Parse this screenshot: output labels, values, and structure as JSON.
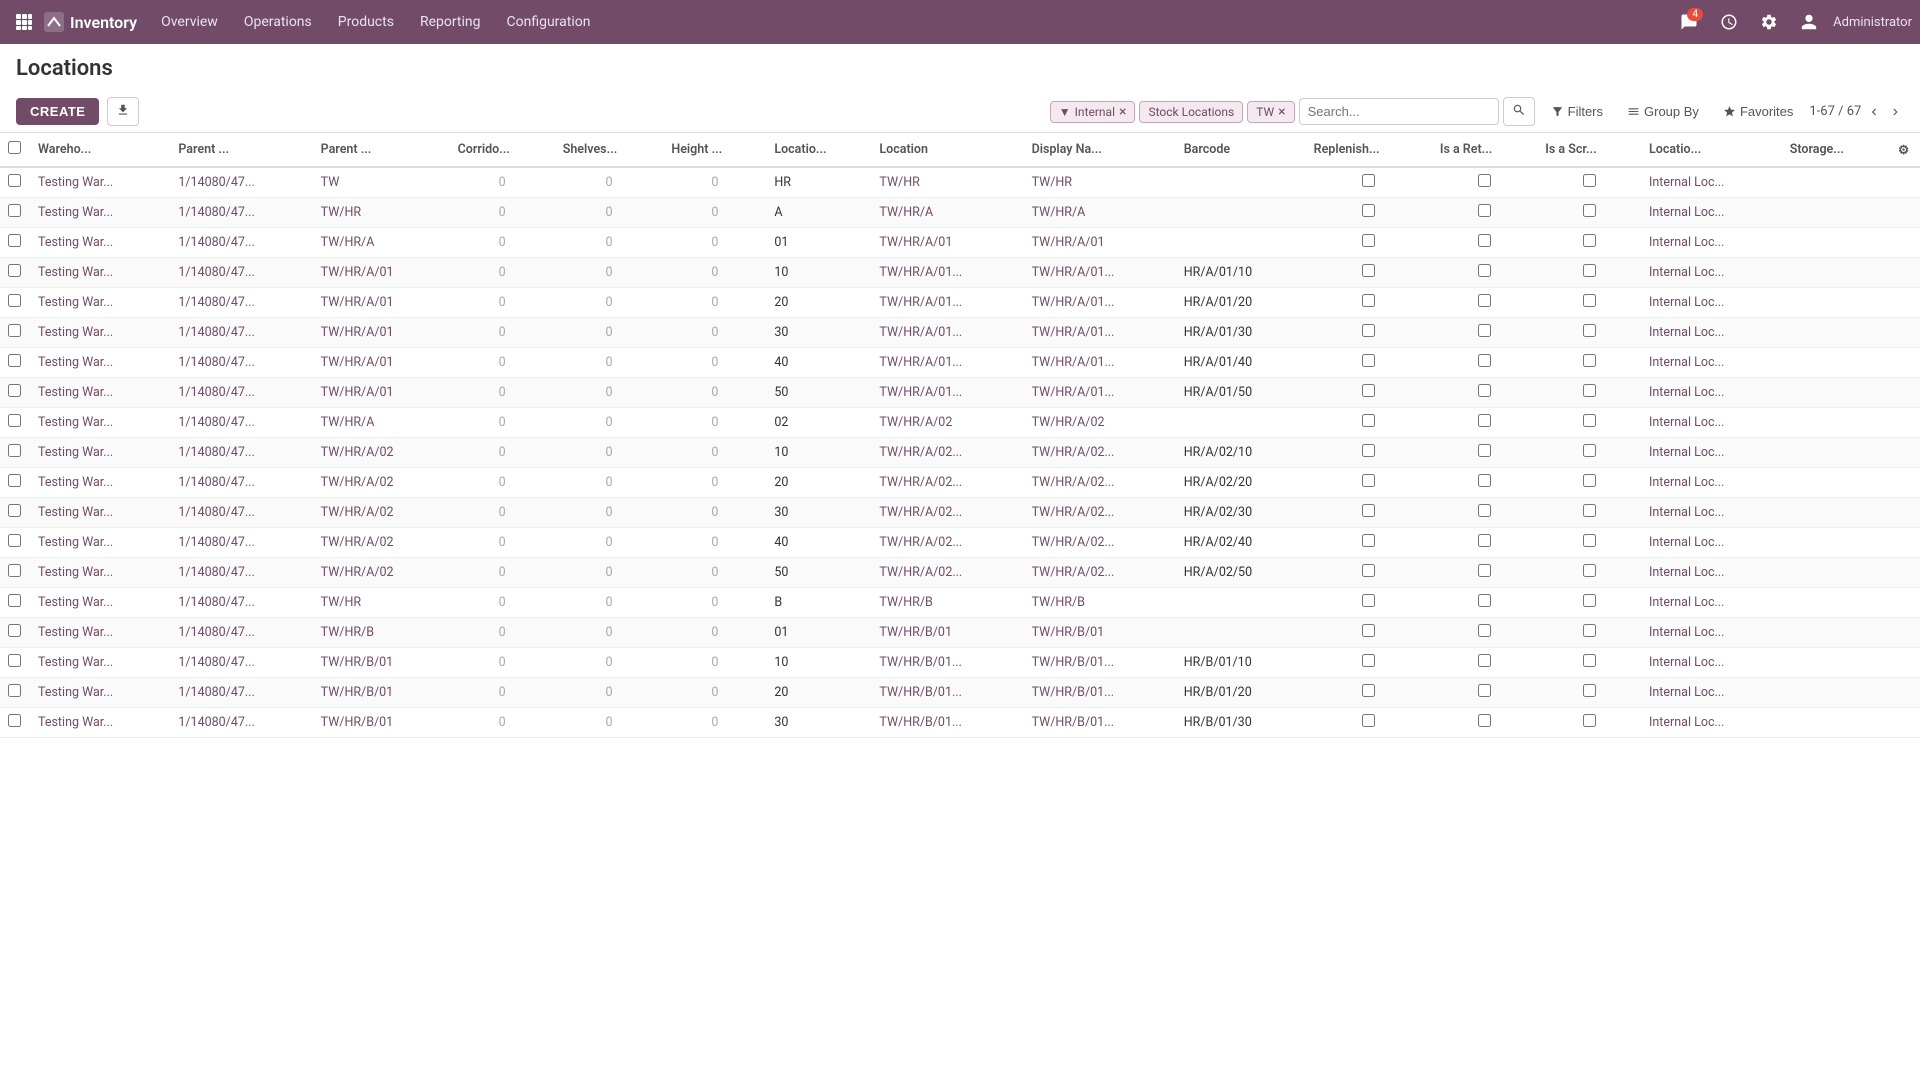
{
  "topnav": {
    "brand": "Inventory",
    "menu": [
      "Overview",
      "Operations",
      "Products",
      "Reporting",
      "Configuration"
    ],
    "chat_count": "4",
    "user": "Administrator"
  },
  "page": {
    "title": "Locations"
  },
  "toolbar": {
    "create_label": "CREATE",
    "filters_label": "Filters",
    "group_by_label": "Group By",
    "favorites_label": "Favorites",
    "pagination": "1-67 / 67"
  },
  "filters": [
    {
      "id": "internal",
      "label": "Internal",
      "removable": true
    },
    {
      "id": "stock",
      "label": "Stock Locations",
      "removable": false
    },
    {
      "id": "tw",
      "label": "TW",
      "removable": true
    }
  ],
  "search_placeholder": "Search...",
  "columns": [
    "Wareho...",
    "Parent ...",
    "Parent ...",
    "Corrido...",
    "Shelves...",
    "Height ...",
    "Locatio...",
    "Location",
    "Display Na...",
    "Barcode",
    "Replenish...",
    "Is a Ret...",
    "Is a Scr...",
    "Locatio...",
    "Storage..."
  ],
  "rows": [
    {
      "warehouse": "Testing War...",
      "parent1": "1/14080/47...",
      "parent2": "TW",
      "corridor": "0",
      "shelves": "0",
      "height": "0",
      "loc_type": "HR",
      "location": "TW/HR",
      "display_name": "TW/HR",
      "barcode": "",
      "replenish": false,
      "is_ret": false,
      "is_scr": false,
      "loc_usage": "Internal Loc...",
      "storage": ""
    },
    {
      "warehouse": "Testing War...",
      "parent1": "1/14080/47...",
      "parent2": "TW/HR",
      "corridor": "0",
      "shelves": "0",
      "height": "0",
      "loc_type": "A",
      "location": "TW/HR/A",
      "display_name": "TW/HR/A",
      "barcode": "",
      "replenish": false,
      "is_ret": false,
      "is_scr": false,
      "loc_usage": "Internal Loc...",
      "storage": ""
    },
    {
      "warehouse": "Testing War...",
      "parent1": "1/14080/47...",
      "parent2": "TW/HR/A",
      "corridor": "0",
      "shelves": "0",
      "height": "0",
      "loc_type": "01",
      "location": "TW/HR/A/01",
      "display_name": "TW/HR/A/01",
      "barcode": "",
      "replenish": false,
      "is_ret": false,
      "is_scr": false,
      "loc_usage": "Internal Loc...",
      "storage": ""
    },
    {
      "warehouse": "Testing War...",
      "parent1": "1/14080/47...",
      "parent2": "TW/HR/A/01",
      "corridor": "0",
      "shelves": "0",
      "height": "0",
      "loc_type": "10",
      "location": "TW/HR/A/01...",
      "display_name": "TW/HR/A/01...",
      "barcode": "HR/A/01/10",
      "replenish": false,
      "is_ret": false,
      "is_scr": false,
      "loc_usage": "Internal Loc...",
      "storage": ""
    },
    {
      "warehouse": "Testing War...",
      "parent1": "1/14080/47...",
      "parent2": "TW/HR/A/01",
      "corridor": "0",
      "shelves": "0",
      "height": "0",
      "loc_type": "20",
      "location": "TW/HR/A/01...",
      "display_name": "TW/HR/A/01...",
      "barcode": "HR/A/01/20",
      "replenish": false,
      "is_ret": false,
      "is_scr": false,
      "loc_usage": "Internal Loc...",
      "storage": ""
    },
    {
      "warehouse": "Testing War...",
      "parent1": "1/14080/47...",
      "parent2": "TW/HR/A/01",
      "corridor": "0",
      "shelves": "0",
      "height": "0",
      "loc_type": "30",
      "location": "TW/HR/A/01...",
      "display_name": "TW/HR/A/01...",
      "barcode": "HR/A/01/30",
      "replenish": false,
      "is_ret": false,
      "is_scr": false,
      "loc_usage": "Internal Loc...",
      "storage": ""
    },
    {
      "warehouse": "Testing War...",
      "parent1": "1/14080/47...",
      "parent2": "TW/HR/A/01",
      "corridor": "0",
      "shelves": "0",
      "height": "0",
      "loc_type": "40",
      "location": "TW/HR/A/01...",
      "display_name": "TW/HR/A/01...",
      "barcode": "HR/A/01/40",
      "replenish": false,
      "is_ret": false,
      "is_scr": false,
      "loc_usage": "Internal Loc...",
      "storage": ""
    },
    {
      "warehouse": "Testing War...",
      "parent1": "1/14080/47...",
      "parent2": "TW/HR/A/01",
      "corridor": "0",
      "shelves": "0",
      "height": "0",
      "loc_type": "50",
      "location": "TW/HR/A/01...",
      "display_name": "TW/HR/A/01...",
      "barcode": "HR/A/01/50",
      "replenish": false,
      "is_ret": false,
      "is_scr": false,
      "loc_usage": "Internal Loc...",
      "storage": ""
    },
    {
      "warehouse": "Testing War...",
      "parent1": "1/14080/47...",
      "parent2": "TW/HR/A",
      "corridor": "0",
      "shelves": "0",
      "height": "0",
      "loc_type": "02",
      "location": "TW/HR/A/02",
      "display_name": "TW/HR/A/02",
      "barcode": "",
      "replenish": false,
      "is_ret": false,
      "is_scr": false,
      "loc_usage": "Internal Loc...",
      "storage": ""
    },
    {
      "warehouse": "Testing War...",
      "parent1": "1/14080/47...",
      "parent2": "TW/HR/A/02",
      "corridor": "0",
      "shelves": "0",
      "height": "0",
      "loc_type": "10",
      "location": "TW/HR/A/02...",
      "display_name": "TW/HR/A/02...",
      "barcode": "HR/A/02/10",
      "replenish": false,
      "is_ret": false,
      "is_scr": false,
      "loc_usage": "Internal Loc...",
      "storage": ""
    },
    {
      "warehouse": "Testing War...",
      "parent1": "1/14080/47...",
      "parent2": "TW/HR/A/02",
      "corridor": "0",
      "shelves": "0",
      "height": "0",
      "loc_type": "20",
      "location": "TW/HR/A/02...",
      "display_name": "TW/HR/A/02...",
      "barcode": "HR/A/02/20",
      "replenish": false,
      "is_ret": false,
      "is_scr": false,
      "loc_usage": "Internal Loc...",
      "storage": ""
    },
    {
      "warehouse": "Testing War...",
      "parent1": "1/14080/47...",
      "parent2": "TW/HR/A/02",
      "corridor": "0",
      "shelves": "0",
      "height": "0",
      "loc_type": "30",
      "location": "TW/HR/A/02...",
      "display_name": "TW/HR/A/02...",
      "barcode": "HR/A/02/30",
      "replenish": false,
      "is_ret": false,
      "is_scr": false,
      "loc_usage": "Internal Loc...",
      "storage": ""
    },
    {
      "warehouse": "Testing War...",
      "parent1": "1/14080/47...",
      "parent2": "TW/HR/A/02",
      "corridor": "0",
      "shelves": "0",
      "height": "0",
      "loc_type": "40",
      "location": "TW/HR/A/02...",
      "display_name": "TW/HR/A/02...",
      "barcode": "HR/A/02/40",
      "replenish": false,
      "is_ret": false,
      "is_scr": false,
      "loc_usage": "Internal Loc...",
      "storage": ""
    },
    {
      "warehouse": "Testing War...",
      "parent1": "1/14080/47...",
      "parent2": "TW/HR/A/02",
      "corridor": "0",
      "shelves": "0",
      "height": "0",
      "loc_type": "50",
      "location": "TW/HR/A/02...",
      "display_name": "TW/HR/A/02...",
      "barcode": "HR/A/02/50",
      "replenish": false,
      "is_ret": false,
      "is_scr": false,
      "loc_usage": "Internal Loc...",
      "storage": ""
    },
    {
      "warehouse": "Testing War...",
      "parent1": "1/14080/47...",
      "parent2": "TW/HR",
      "corridor": "0",
      "shelves": "0",
      "height": "0",
      "loc_type": "B",
      "location": "TW/HR/B",
      "display_name": "TW/HR/B",
      "barcode": "",
      "replenish": false,
      "is_ret": false,
      "is_scr": false,
      "loc_usage": "Internal Loc...",
      "storage": ""
    },
    {
      "warehouse": "Testing War...",
      "parent1": "1/14080/47...",
      "parent2": "TW/HR/B",
      "corridor": "0",
      "shelves": "0",
      "height": "0",
      "loc_type": "01",
      "location": "TW/HR/B/01",
      "display_name": "TW/HR/B/01",
      "barcode": "",
      "replenish": false,
      "is_ret": false,
      "is_scr": false,
      "loc_usage": "Internal Loc...",
      "storage": ""
    },
    {
      "warehouse": "Testing War...",
      "parent1": "1/14080/47...",
      "parent2": "TW/HR/B/01",
      "corridor": "0",
      "shelves": "0",
      "height": "0",
      "loc_type": "10",
      "location": "TW/HR/B/01...",
      "display_name": "TW/HR/B/01...",
      "barcode": "HR/B/01/10",
      "replenish": false,
      "is_ret": false,
      "is_scr": false,
      "loc_usage": "Internal Loc...",
      "storage": ""
    },
    {
      "warehouse": "Testing War...",
      "parent1": "1/14080/47...",
      "parent2": "TW/HR/B/01",
      "corridor": "0",
      "shelves": "0",
      "height": "0",
      "loc_type": "20",
      "location": "TW/HR/B/01...",
      "display_name": "TW/HR/B/01...",
      "barcode": "HR/B/01/20",
      "replenish": false,
      "is_ret": false,
      "is_scr": false,
      "loc_usage": "Internal Loc...",
      "storage": ""
    },
    {
      "warehouse": "Testing War...",
      "parent1": "1/14080/47...",
      "parent2": "TW/HR/B/01",
      "corridor": "0",
      "shelves": "0",
      "height": "0",
      "loc_type": "30",
      "location": "TW/HR/B/01...",
      "display_name": "TW/HR/B/01...",
      "barcode": "HR/B/01/30",
      "replenish": false,
      "is_ret": false,
      "is_scr": false,
      "loc_usage": "Internal Loc...",
      "storage": ""
    }
  ]
}
